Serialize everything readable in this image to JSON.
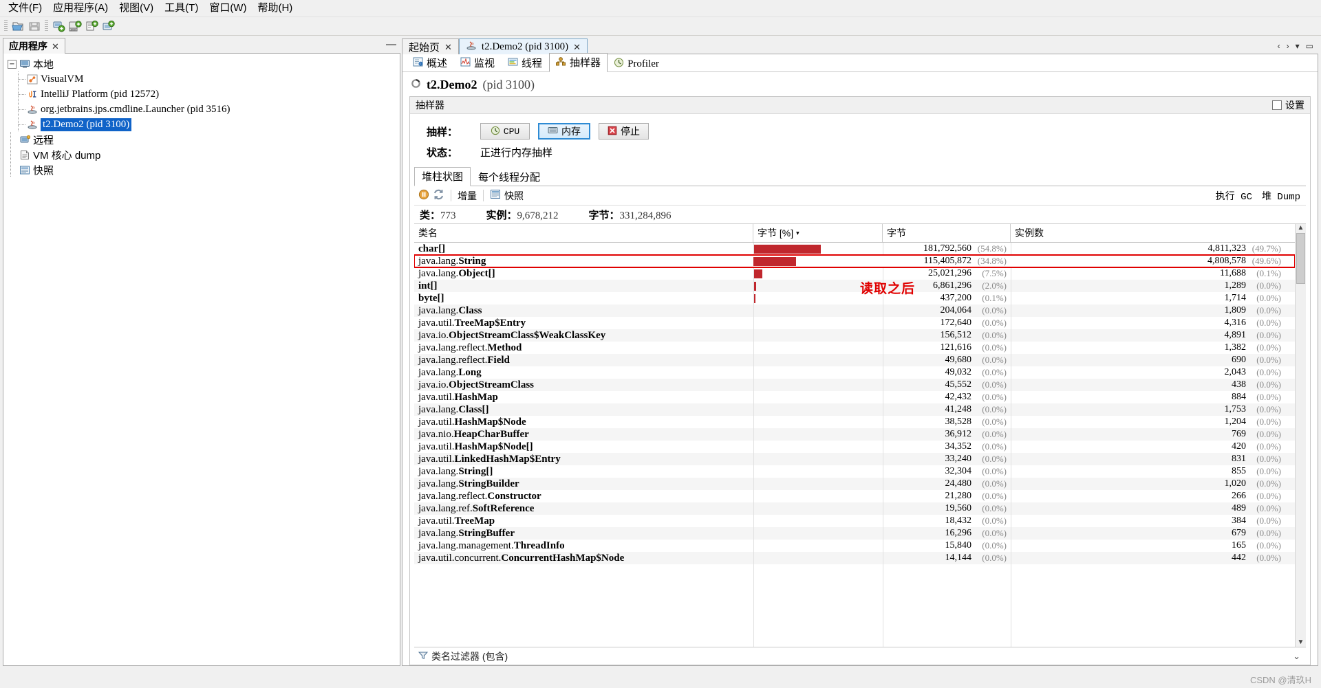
{
  "menubar": {
    "items": [
      {
        "label": "文件(F)"
      },
      {
        "label": "应用程序(A)"
      },
      {
        "label": "视图(V)"
      },
      {
        "label": "工具(T)"
      },
      {
        "label": "窗口(W)"
      },
      {
        "label": "帮助(H)"
      }
    ]
  },
  "toolbar": {
    "buttons": [
      {
        "name": "open-snapshot-icon"
      },
      {
        "name": "save-snapshot-icon"
      },
      {
        "name": "add-remote-host-icon"
      },
      {
        "name": "add-jmx-connection-icon"
      },
      {
        "name": "add-vm-coredump-icon"
      },
      {
        "name": "add-application-icon"
      }
    ]
  },
  "left_panel": {
    "tab_label": "应用程序",
    "close_glyph": "✕",
    "minimize_glyph": "—",
    "tree": [
      {
        "label": "本地",
        "icon": "computer-icon",
        "depth": 0,
        "expanded": true,
        "selected": false
      },
      {
        "label": "VisualVM",
        "icon": "visualvm-icon",
        "depth": 1,
        "selected": false
      },
      {
        "label": "IntelliJ Platform (pid 12572)",
        "icon": "intellij-icon",
        "depth": 1,
        "selected": false
      },
      {
        "label": "org.jetbrains.jps.cmdline.Launcher (pid 3516)",
        "icon": "java-icon",
        "depth": 1,
        "selected": false
      },
      {
        "label": "t2.Demo2 (pid 3100)",
        "icon": "java-icon",
        "depth": 1,
        "selected": true
      },
      {
        "label": "远程",
        "icon": "remote-icon",
        "depth": 0,
        "selected": false
      },
      {
        "label": "VM 核心 dump",
        "icon": "coredump-icon",
        "depth": 0,
        "selected": false
      },
      {
        "label": "快照",
        "icon": "snapshot-icon",
        "depth": 0,
        "selected": false
      }
    ]
  },
  "document_tabs": [
    {
      "label": "起始页",
      "icon": "none",
      "active": false,
      "close_glyph": "✕"
    },
    {
      "label": "t2.Demo2 (pid 3100)",
      "icon": "java-icon",
      "active": true,
      "close_glyph": "✕"
    }
  ],
  "tab_nav": {
    "left_glyph": "‹",
    "right_glyph": "›",
    "list_glyph": "▾",
    "max_glyph": "▭"
  },
  "sub_tabs": [
    {
      "label": "概述",
      "icon": "overview-icon",
      "active": false
    },
    {
      "label": "监视",
      "icon": "monitor-icon",
      "active": false
    },
    {
      "label": "线程",
      "icon": "threads-icon",
      "active": false
    },
    {
      "label": "抽样器",
      "icon": "sampler-icon",
      "active": true
    },
    {
      "label": "Profiler",
      "icon": "profiler-icon",
      "active": false
    }
  ],
  "app_header": {
    "name": "t2.Demo2",
    "pid": "(pid 3100)",
    "status_icon": "loading-spinner-icon"
  },
  "sampler_panel": {
    "title": "抽样器",
    "settings_label": "设置",
    "sample_label": "抽样：",
    "status_label": "状态：",
    "status_value": "正进行内存抽样",
    "buttons": [
      {
        "label": "CPU",
        "icon": "cpu-clock-icon",
        "selected": false
      },
      {
        "label": "内存",
        "icon": "memory-icon",
        "selected": true
      },
      {
        "label": "停止",
        "icon": "stop-icon",
        "selected": false
      }
    ]
  },
  "histogram": {
    "tabs": [
      {
        "label": "堆柱状图",
        "active": true
      },
      {
        "label": "每个线程分配",
        "active": false
      }
    ],
    "toolbar": {
      "pause_icon": "pause-icon",
      "refresh_icon": "refresh-icon",
      "delta_label": "增量",
      "snapshot_icon": "snapshot-icon",
      "snapshot_label": "快照",
      "gc_label": "执行 GC",
      "heapdump_label": "堆 Dump"
    },
    "stats": [
      {
        "label": "类：",
        "value": "773"
      },
      {
        "label": "实例：",
        "value": "9,678,212"
      },
      {
        "label": "字节：",
        "value": "331,284,896"
      }
    ],
    "columns": [
      {
        "label": "类名",
        "sorted": false
      },
      {
        "label": "字节 [%]",
        "sorted": true,
        "arrow": "▾"
      },
      {
        "label": "字节",
        "sorted": false
      },
      {
        "label": "实例数",
        "sorted": false
      }
    ],
    "annotation": "读取之后",
    "filter_label": "类名过滤器 (包含)",
    "filter_icon": "filter-icon",
    "filter_expand_glyph": "⌄",
    "rows": [
      {
        "class": "char[]",
        "pkg": "",
        "bar_pct": 54.8,
        "bytes": "181,792,560",
        "bytes_pct": "(54.8%)",
        "instances": "4,811,323",
        "inst_pct": "(49.7%)",
        "highlight": false
      },
      {
        "class": "String",
        "pkg": "java.lang.",
        "bar_pct": 34.8,
        "bytes": "115,405,872",
        "bytes_pct": "(34.8%)",
        "instances": "4,808,578",
        "inst_pct": "(49.6%)",
        "highlight": true
      },
      {
        "class": "Object[]",
        "pkg": "java.lang.",
        "bar_pct": 7.5,
        "bytes": "25,021,296",
        "bytes_pct": "(7.5%)",
        "instances": "11,688",
        "inst_pct": "(0.1%)",
        "highlight": false
      },
      {
        "class": "int[]",
        "pkg": "",
        "bar_pct": 2.0,
        "bytes": "6,861,296",
        "bytes_pct": "(2.0%)",
        "instances": "1,289",
        "inst_pct": "(0.0%)",
        "highlight": false
      },
      {
        "class": "byte[]",
        "pkg": "",
        "bar_pct": 0.1,
        "bytes": "437,200",
        "bytes_pct": "(0.1%)",
        "instances": "1,714",
        "inst_pct": "(0.0%)",
        "highlight": false
      },
      {
        "class": "Class",
        "pkg": "java.lang.",
        "bar_pct": 0.0,
        "bytes": "204,064",
        "bytes_pct": "(0.0%)",
        "instances": "1,809",
        "inst_pct": "(0.0%)",
        "highlight": false
      },
      {
        "class": "TreeMap$Entry",
        "pkg": "java.util.",
        "bar_pct": 0.0,
        "bytes": "172,640",
        "bytes_pct": "(0.0%)",
        "instances": "4,316",
        "inst_pct": "(0.0%)",
        "highlight": false
      },
      {
        "class": "ObjectStreamClass$WeakClassKey",
        "pkg": "java.io.",
        "bar_pct": 0.0,
        "bytes": "156,512",
        "bytes_pct": "(0.0%)",
        "instances": "4,891",
        "inst_pct": "(0.0%)",
        "highlight": false
      },
      {
        "class": "Method",
        "pkg": "java.lang.reflect.",
        "bar_pct": 0.0,
        "bytes": "121,616",
        "bytes_pct": "(0.0%)",
        "instances": "1,382",
        "inst_pct": "(0.0%)",
        "highlight": false
      },
      {
        "class": "Field",
        "pkg": "java.lang.reflect.",
        "bar_pct": 0.0,
        "bytes": "49,680",
        "bytes_pct": "(0.0%)",
        "instances": "690",
        "inst_pct": "(0.0%)",
        "highlight": false
      },
      {
        "class": "Long",
        "pkg": "java.lang.",
        "bar_pct": 0.0,
        "bytes": "49,032",
        "bytes_pct": "(0.0%)",
        "instances": "2,043",
        "inst_pct": "(0.0%)",
        "highlight": false
      },
      {
        "class": "ObjectStreamClass",
        "pkg": "java.io.",
        "bar_pct": 0.0,
        "bytes": "45,552",
        "bytes_pct": "(0.0%)",
        "instances": "438",
        "inst_pct": "(0.0%)",
        "highlight": false
      },
      {
        "class": "HashMap",
        "pkg": "java.util.",
        "bar_pct": 0.0,
        "bytes": "42,432",
        "bytes_pct": "(0.0%)",
        "instances": "884",
        "inst_pct": "(0.0%)",
        "highlight": false
      },
      {
        "class": "Class[]",
        "pkg": "java.lang.",
        "bar_pct": 0.0,
        "bytes": "41,248",
        "bytes_pct": "(0.0%)",
        "instances": "1,753",
        "inst_pct": "(0.0%)",
        "highlight": false
      },
      {
        "class": "HashMap$Node",
        "pkg": "java.util.",
        "bar_pct": 0.0,
        "bytes": "38,528",
        "bytes_pct": "(0.0%)",
        "instances": "1,204",
        "inst_pct": "(0.0%)",
        "highlight": false
      },
      {
        "class": "HeapCharBuffer",
        "pkg": "java.nio.",
        "bar_pct": 0.0,
        "bytes": "36,912",
        "bytes_pct": "(0.0%)",
        "instances": "769",
        "inst_pct": "(0.0%)",
        "highlight": false
      },
      {
        "class": "HashMap$Node[]",
        "pkg": "java.util.",
        "bar_pct": 0.0,
        "bytes": "34,352",
        "bytes_pct": "(0.0%)",
        "instances": "420",
        "inst_pct": "(0.0%)",
        "highlight": false
      },
      {
        "class": "LinkedHashMap$Entry",
        "pkg": "java.util.",
        "bar_pct": 0.0,
        "bytes": "33,240",
        "bytes_pct": "(0.0%)",
        "instances": "831",
        "inst_pct": "(0.0%)",
        "highlight": false
      },
      {
        "class": "String[]",
        "pkg": "java.lang.",
        "bar_pct": 0.0,
        "bytes": "32,304",
        "bytes_pct": "(0.0%)",
        "instances": "855",
        "inst_pct": "(0.0%)",
        "highlight": false
      },
      {
        "class": "StringBuilder",
        "pkg": "java.lang.",
        "bar_pct": 0.0,
        "bytes": "24,480",
        "bytes_pct": "(0.0%)",
        "instances": "1,020",
        "inst_pct": "(0.0%)",
        "highlight": false
      },
      {
        "class": "Constructor",
        "pkg": "java.lang.reflect.",
        "bar_pct": 0.0,
        "bytes": "21,280",
        "bytes_pct": "(0.0%)",
        "instances": "266",
        "inst_pct": "(0.0%)",
        "highlight": false
      },
      {
        "class": "SoftReference",
        "pkg": "java.lang.ref.",
        "bar_pct": 0.0,
        "bytes": "19,560",
        "bytes_pct": "(0.0%)",
        "instances": "489",
        "inst_pct": "(0.0%)",
        "highlight": false
      },
      {
        "class": "TreeMap",
        "pkg": "java.util.",
        "bar_pct": 0.0,
        "bytes": "18,432",
        "bytes_pct": "(0.0%)",
        "instances": "384",
        "inst_pct": "(0.0%)",
        "highlight": false
      },
      {
        "class": "StringBuffer",
        "pkg": "java.lang.",
        "bar_pct": 0.0,
        "bytes": "16,296",
        "bytes_pct": "(0.0%)",
        "instances": "679",
        "inst_pct": "(0.0%)",
        "highlight": false
      },
      {
        "class": "ThreadInfo",
        "pkg": "java.lang.management.",
        "bar_pct": 0.0,
        "bytes": "15,840",
        "bytes_pct": "(0.0%)",
        "instances": "165",
        "inst_pct": "(0.0%)",
        "highlight": false
      },
      {
        "class": "ConcurrentHashMap$Node",
        "pkg": "java.util.concurrent.",
        "bar_pct": 0.0,
        "bytes": "14,144",
        "bytes_pct": "(0.0%)",
        "instances": "442",
        "inst_pct": "(0.0%)",
        "highlight": false
      }
    ]
  },
  "watermark": "CSDN @清玖H",
  "colors": {
    "bar": "#c0272d",
    "highlight": "#e00000",
    "selection": "#1063c8",
    "accent": "#2e8bd4"
  }
}
